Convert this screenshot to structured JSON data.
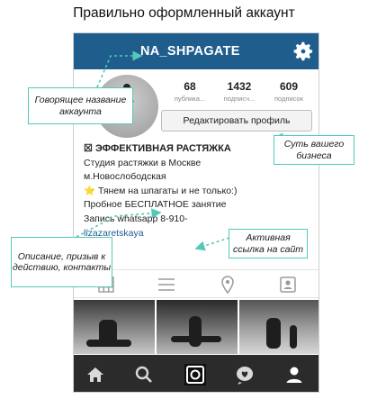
{
  "caption": "Правильно оформленный аккаунт",
  "profile": {
    "username": "NA_SHPAGATE",
    "stats": [
      {
        "value": "68",
        "label": "публика..."
      },
      {
        "value": "1432",
        "label": "подписч..."
      },
      {
        "value": "609",
        "label": "подписок"
      }
    ],
    "edit_label": "Редактировать профиль",
    "bio": {
      "headline_emoji": "☒",
      "headline": "ЭФФЕКТИВНАЯ РАСТЯЖКА",
      "line1": "Студия растяжки в Москве",
      "line2": "м.Новослободская",
      "line3": "⭐ Тянем на шпагаты и не только:)",
      "line4": "Пробное БЕСПЛАТНОЕ занятие",
      "line5": "Запись whatsapp 8-910-",
      "link": "lizazaretskaya"
    }
  },
  "icons": {
    "settings": "gear-icon",
    "tabs": [
      "grid-icon",
      "list-icon",
      "location-pin-icon",
      "tagged-user-icon"
    ],
    "bottom_nav": [
      "home-icon",
      "search-icon",
      "camera-icon",
      "activity-heart-icon",
      "profile-icon"
    ]
  },
  "callouts": {
    "account_name": "Говорящее название аккаунта",
    "business": "Суть вашего бизнеса",
    "active_link": "Активная ссылка на сайт",
    "description": "Описание, призыв к действию, контакты"
  },
  "colors": {
    "topbar": "#1f5d8d",
    "callout_border": "#53c9b8",
    "link": "#1e5b94",
    "bottom_bar": "#2b2b2b"
  }
}
